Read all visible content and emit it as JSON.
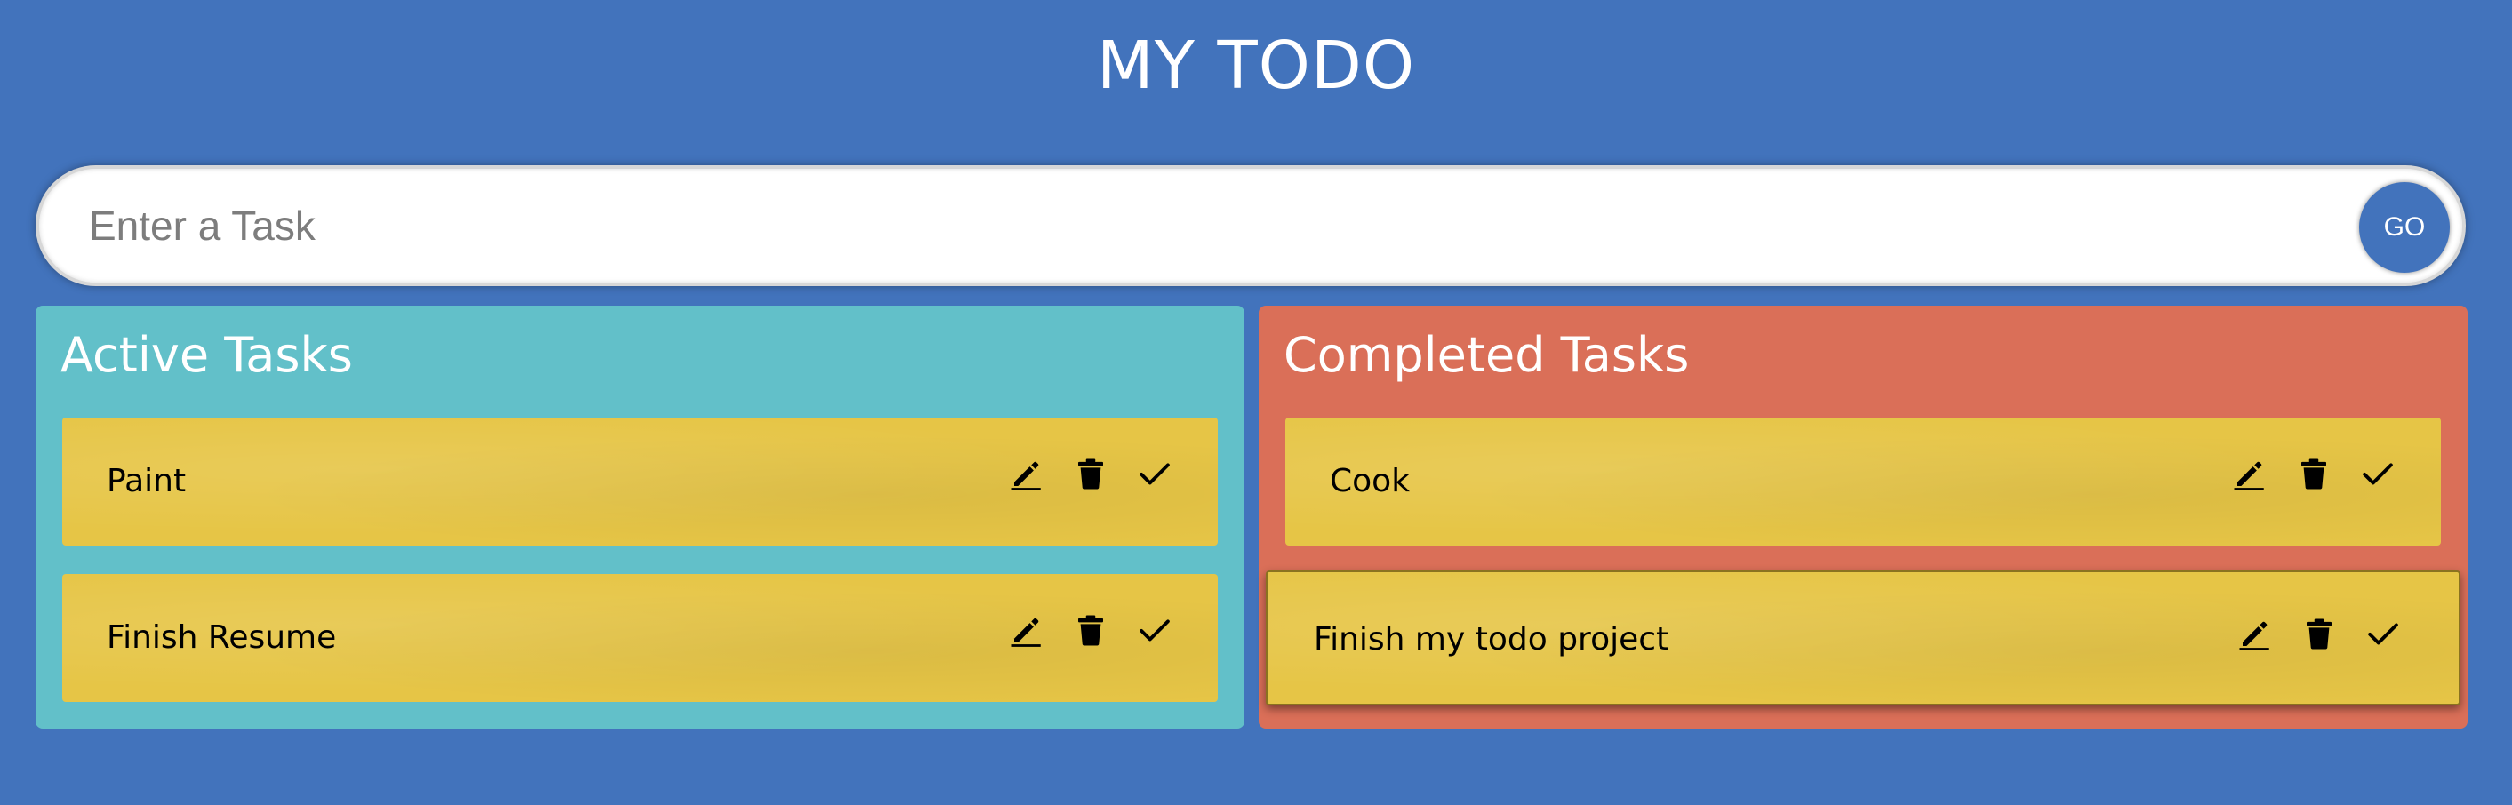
{
  "app": {
    "title": "MY TODO"
  },
  "input": {
    "placeholder": "Enter a Task",
    "value": "",
    "go_label": "GO"
  },
  "active": {
    "heading": "Active Tasks",
    "tasks": [
      {
        "label": "Paint"
      },
      {
        "label": "Finish Resume"
      }
    ]
  },
  "completed": {
    "heading": "Completed Tasks",
    "tasks": [
      {
        "label": "Cook"
      },
      {
        "label": "Finish my todo project"
      }
    ]
  },
  "icons": {
    "edit": "pencil-icon",
    "delete": "trash-icon",
    "complete": "checkmark-icon"
  },
  "colors": {
    "background": "#4273bc",
    "active_panel": "#62c0c9",
    "completed_panel": "#da6f58",
    "task_card": "#e6c546",
    "go_button": "#4273bc"
  }
}
